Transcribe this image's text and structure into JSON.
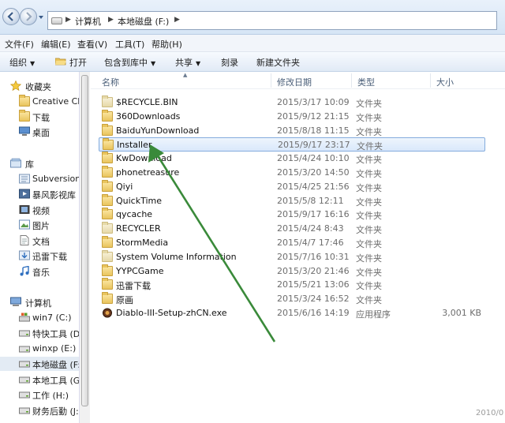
{
  "address": {
    "crumbs": [
      "计算机",
      "本地磁盘 (F:)"
    ]
  },
  "menu": [
    "文件(F)",
    "编辑(E)",
    "查看(V)",
    "工具(T)",
    "帮助(H)"
  ],
  "toolbar": {
    "organize": "组织",
    "open": "打开",
    "include_in_library": "包含到库中",
    "share": "共享",
    "burn": "刻录",
    "new_folder": "新建文件夹"
  },
  "nav": {
    "favorites": "收藏夹",
    "fav_items": [
      "Creative Clo",
      "下载",
      "桌面"
    ],
    "libraries": "库",
    "lib_items": [
      "Subversion",
      "暴风影视库",
      "视频",
      "图片",
      "文档",
      "迅雷下载",
      "音乐"
    ],
    "computer": "计算机",
    "drives": [
      "win7 (C:)",
      "特快工具 (D:",
      "winxp (E:)",
      "本地磁盘 (F:",
      "本地工具 (G:",
      "工作 (H:)",
      "财务后勤 (J:"
    ]
  },
  "columns": {
    "name": "名称",
    "modified": "修改日期",
    "type": "类型",
    "size": "大小"
  },
  "files": [
    {
      "name": "$RECYCLE.BIN",
      "date": "2015/3/17 10:09",
      "type": "文件夹",
      "size": ""
    },
    {
      "name": "360Downloads",
      "date": "2015/9/12 21:15",
      "type": "文件夹",
      "size": ""
    },
    {
      "name": "BaiduYunDownload",
      "date": "2015/8/18 11:15",
      "type": "文件夹",
      "size": ""
    },
    {
      "name": "Installer",
      "date": "2015/9/17 23:17",
      "type": "文件夹",
      "size": ""
    },
    {
      "name": "KwDownload",
      "date": "2015/4/24 10:10",
      "type": "文件夹",
      "size": ""
    },
    {
      "name": "phonetreasure",
      "date": "2015/3/20 14:50",
      "type": "文件夹",
      "size": ""
    },
    {
      "name": "Qiyi",
      "date": "2015/4/25 21:56",
      "type": "文件夹",
      "size": ""
    },
    {
      "name": "QuickTime",
      "date": "2015/5/8 12:11",
      "type": "文件夹",
      "size": ""
    },
    {
      "name": "qycache",
      "date": "2015/9/17 16:16",
      "type": "文件夹",
      "size": ""
    },
    {
      "name": "RECYCLER",
      "date": "2015/4/24 8:43",
      "type": "文件夹",
      "size": ""
    },
    {
      "name": "StormMedia",
      "date": "2015/4/7 17:46",
      "type": "文件夹",
      "size": ""
    },
    {
      "name": "System Volume Information",
      "date": "2015/7/16 10:31",
      "type": "文件夹",
      "size": ""
    },
    {
      "name": "YYPCGame",
      "date": "2015/3/20 21:46",
      "type": "文件夹",
      "size": ""
    },
    {
      "name": "迅雷下载",
      "date": "2015/5/21 13:06",
      "type": "文件夹",
      "size": ""
    },
    {
      "name": "原画",
      "date": "2015/3/24 16:52",
      "type": "文件夹",
      "size": ""
    },
    {
      "name": "Diablo-III-Setup-zhCN.exe",
      "date": "2015/6/16 14:19",
      "type": "应用程序",
      "size": "3,001 KB"
    }
  ],
  "watermark": "2010/0",
  "colors": {
    "annotation_arrow": "#3a8a3a",
    "selection": "#84acdd"
  }
}
